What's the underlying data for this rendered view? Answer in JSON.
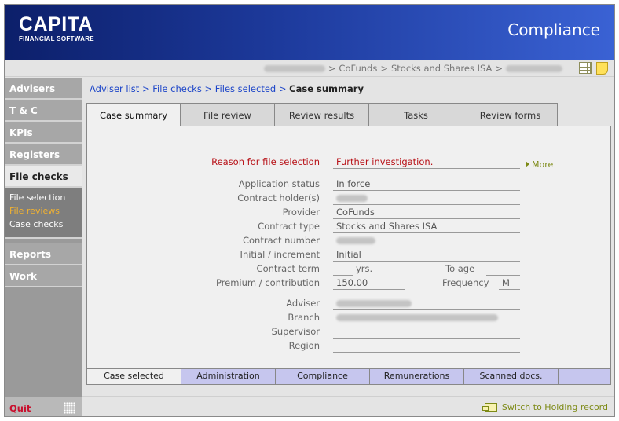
{
  "header": {
    "logo_main": "CAPITA",
    "logo_sub": "FINANCIAL SOFTWARE",
    "app_title": "Compliance"
  },
  "pathbar": {
    "segments": [
      "CoFunds",
      "Stocks and Shares ISA"
    ],
    "separator": ">"
  },
  "sidebar": {
    "items": [
      {
        "label": "Advisers"
      },
      {
        "label": "T & C"
      },
      {
        "label": "KPIs"
      },
      {
        "label": "Registers"
      },
      {
        "label": "File checks"
      }
    ],
    "subitems": [
      "File selection",
      "File reviews",
      "Case checks"
    ],
    "items_after": [
      {
        "label": "Reports"
      },
      {
        "label": "Work"
      }
    ],
    "quit_label": "Quit"
  },
  "breadcrumb": {
    "links": [
      "Adviser list",
      "File checks",
      "Files selected"
    ],
    "current": "Case summary",
    "separator": ">"
  },
  "tabs_top": [
    "Case summary",
    "File review",
    "Review results",
    "Tasks",
    "Review forms"
  ],
  "form": {
    "reason_label": "Reason for file selection",
    "reason_value": "Further investigation.",
    "more_label": "More",
    "fields": {
      "application_status": {
        "label": "Application status",
        "value": "In force"
      },
      "contract_holder": {
        "label": "Contract holder(s)",
        "value": ""
      },
      "provider": {
        "label": "Provider",
        "value": "CoFunds"
      },
      "contract_type": {
        "label": "Contract type",
        "value": "Stocks and Shares ISA"
      },
      "contract_number": {
        "label": "Contract number",
        "value": ""
      },
      "initial_increment": {
        "label": "Initial / increment",
        "value": "Initial"
      },
      "contract_term": {
        "label": "Contract term",
        "unit": "yrs."
      },
      "to_age": {
        "label": "To age",
        "value": ""
      },
      "premium": {
        "label": "Premium / contribution",
        "value": "150.00"
      },
      "frequency": {
        "label": "Frequency",
        "value": "M"
      },
      "adviser": {
        "label": "Adviser",
        "value": ""
      },
      "branch": {
        "label": "Branch",
        "value": ""
      },
      "supervisor": {
        "label": "Supervisor",
        "value": ""
      },
      "region": {
        "label": "Region",
        "value": ""
      }
    }
  },
  "tabs_bottom": [
    "Case selected",
    "Administration",
    "Compliance",
    "Remunerations",
    "Scanned docs."
  ],
  "footer": {
    "switch_label": "Switch to Holding record"
  },
  "colors": {
    "header_dark": "#0c1f6a",
    "header_light": "#3a62d4",
    "link_blue": "#1b44c8",
    "alert_red": "#b81218",
    "olive": "#7d8a16",
    "current_orange": "#f2b230"
  }
}
